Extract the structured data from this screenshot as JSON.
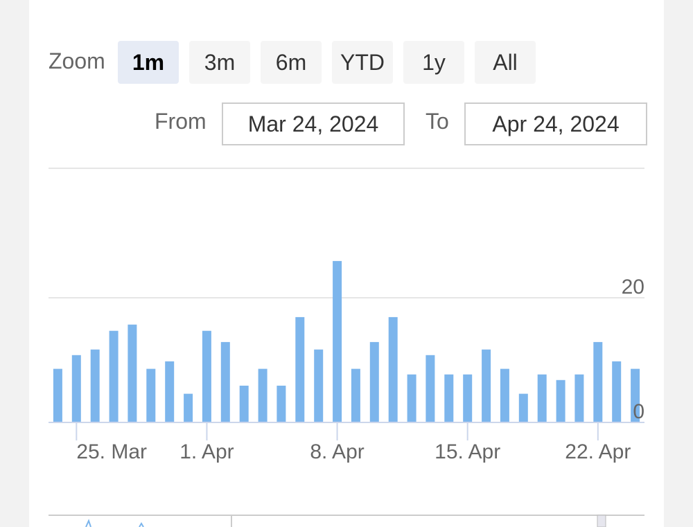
{
  "range_selector": {
    "zoom_label": "Zoom",
    "buttons": [
      "1m",
      "3m",
      "6m",
      "YTD",
      "1y",
      "All"
    ],
    "active": "1m",
    "from_label": "From",
    "from_value": "Mar 24, 2024",
    "to_label": "To",
    "to_value": "Apr 24, 2024"
  },
  "chart_data": {
    "type": "bar",
    "color": "#7cb5ec",
    "grid_color": "#e6e6e6",
    "x_ticks": [
      "25. Mar",
      "1. Apr",
      "8. Apr",
      "15. Apr",
      "22. Apr"
    ],
    "y_ticks": [
      "0",
      "20"
    ],
    "ylim": [
      0,
      20
    ],
    "categories": [
      "2024-03-24",
      "2024-03-25",
      "2024-03-26",
      "2024-03-27",
      "2024-03-28",
      "2024-03-29",
      "2024-03-30",
      "2024-03-31",
      "2024-04-01",
      "2024-04-02",
      "2024-04-03",
      "2024-04-04",
      "2024-04-05",
      "2024-04-06",
      "2024-04-07",
      "2024-04-08",
      "2024-04-09",
      "2024-04-10",
      "2024-04-11",
      "2024-04-12",
      "2024-04-13",
      "2024-04-14",
      "2024-04-15",
      "2024-04-16",
      "2024-04-17",
      "2024-04-18",
      "2024-04-19",
      "2024-04-20",
      "2024-04-21",
      "2024-04-22",
      "2024-04-23",
      "2024-04-24"
    ],
    "values": [
      8.6,
      10.8,
      11.7,
      14.7,
      15.7,
      8.6,
      9.8,
      4.6,
      14.7,
      12.9,
      5.9,
      8.6,
      5.9,
      16.9,
      11.7,
      25.9,
      8.6,
      12.9,
      16.9,
      7.7,
      10.8,
      7.7,
      7.7,
      11.7,
      8.6,
      4.6,
      7.7,
      6.8,
      7.7,
      12.9,
      9.8,
      8.6
    ]
  }
}
